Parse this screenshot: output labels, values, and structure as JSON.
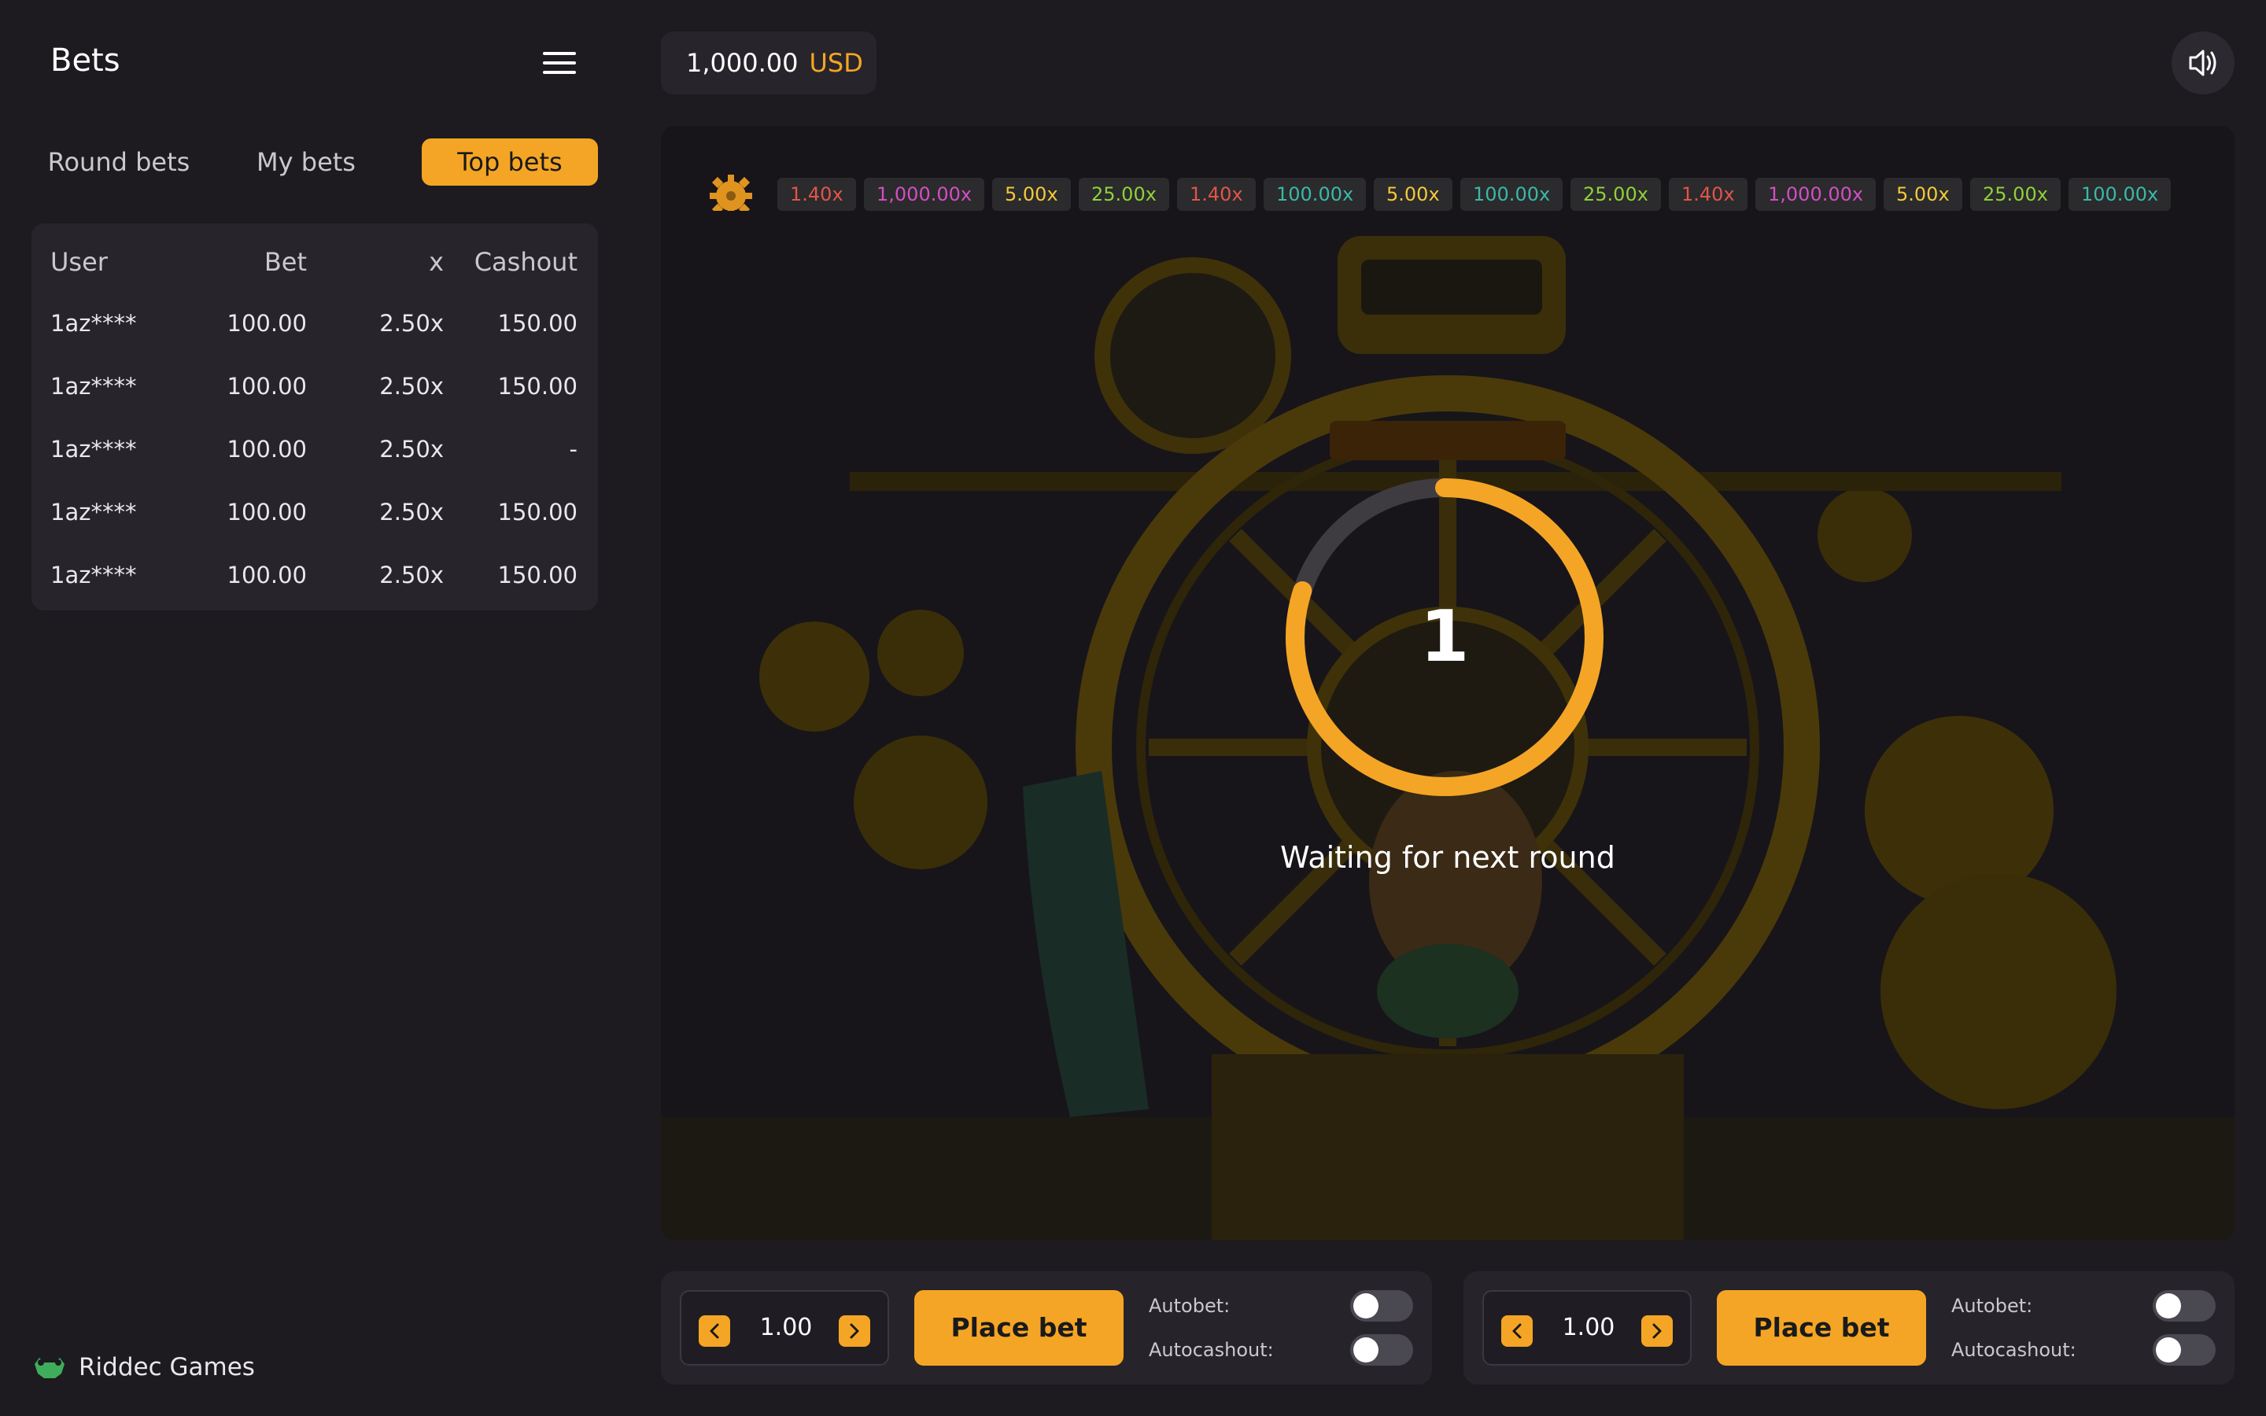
{
  "sidebar": {
    "title": "Bets",
    "tabs": [
      {
        "label": "Round bets"
      },
      {
        "label": "My bets"
      },
      {
        "label": "Top bets",
        "active": true
      }
    ],
    "table": {
      "headers": {
        "user": "User",
        "bet": "Bet",
        "x": "x",
        "cashout": "Cashout"
      },
      "rows": [
        {
          "user": "1az****",
          "bet": "100.00",
          "x": "2.50x",
          "cashout": "150.00"
        },
        {
          "user": "1az****",
          "bet": "100.00",
          "x": "2.50x",
          "cashout": "150.00"
        },
        {
          "user": "1az****",
          "bet": "100.00",
          "x": "2.50x",
          "cashout": "-"
        },
        {
          "user": "1az****",
          "bet": "100.00",
          "x": "2.50x",
          "cashout": "150.00"
        },
        {
          "user": "1az****",
          "bet": "100.00",
          "x": "2.50x",
          "cashout": "150.00"
        }
      ]
    },
    "brand": "Riddec Games"
  },
  "balance": {
    "amount": "1,000.00",
    "currency": "USD"
  },
  "history": [
    {
      "label": "1.40x",
      "color": "#e0554a"
    },
    {
      "label": "1,000.00x",
      "color": "#d14fc4"
    },
    {
      "label": "5.00x",
      "color": "#f2c93a"
    },
    {
      "label": "25.00x",
      "color": "#8fd13a"
    },
    {
      "label": "1.40x",
      "color": "#e0554a"
    },
    {
      "label": "100.00x",
      "color": "#3ab8a8"
    },
    {
      "label": "5.00x",
      "color": "#f2c93a"
    },
    {
      "label": "100.00x",
      "color": "#3ab8a8"
    },
    {
      "label": "25.00x",
      "color": "#8fd13a"
    },
    {
      "label": "1.40x",
      "color": "#e0554a"
    },
    {
      "label": "1,000.00x",
      "color": "#d14fc4"
    },
    {
      "label": "5.00x",
      "color": "#f2c93a"
    },
    {
      "label": "25.00x",
      "color": "#8fd13a"
    },
    {
      "label": "100.00x",
      "color": "#3ab8a8"
    }
  ],
  "countdown": {
    "value": "1",
    "progress": 0.8,
    "status": "Waiting for next round"
  },
  "bet_panels": [
    {
      "amount": "1.00",
      "button": "Place bet",
      "autobet_label": "Autobet:",
      "autocashout_label": "Autocashout:",
      "autobet": false,
      "autocashout": false
    },
    {
      "amount": "1.00",
      "button": "Place bet",
      "autobet_label": "Autobet:",
      "autocashout_label": "Autocashout:",
      "autobet": false,
      "autocashout": false
    }
  ],
  "colors": {
    "accent": "#f5a525",
    "background": "#1d1b20",
    "panel": "#27252b"
  }
}
